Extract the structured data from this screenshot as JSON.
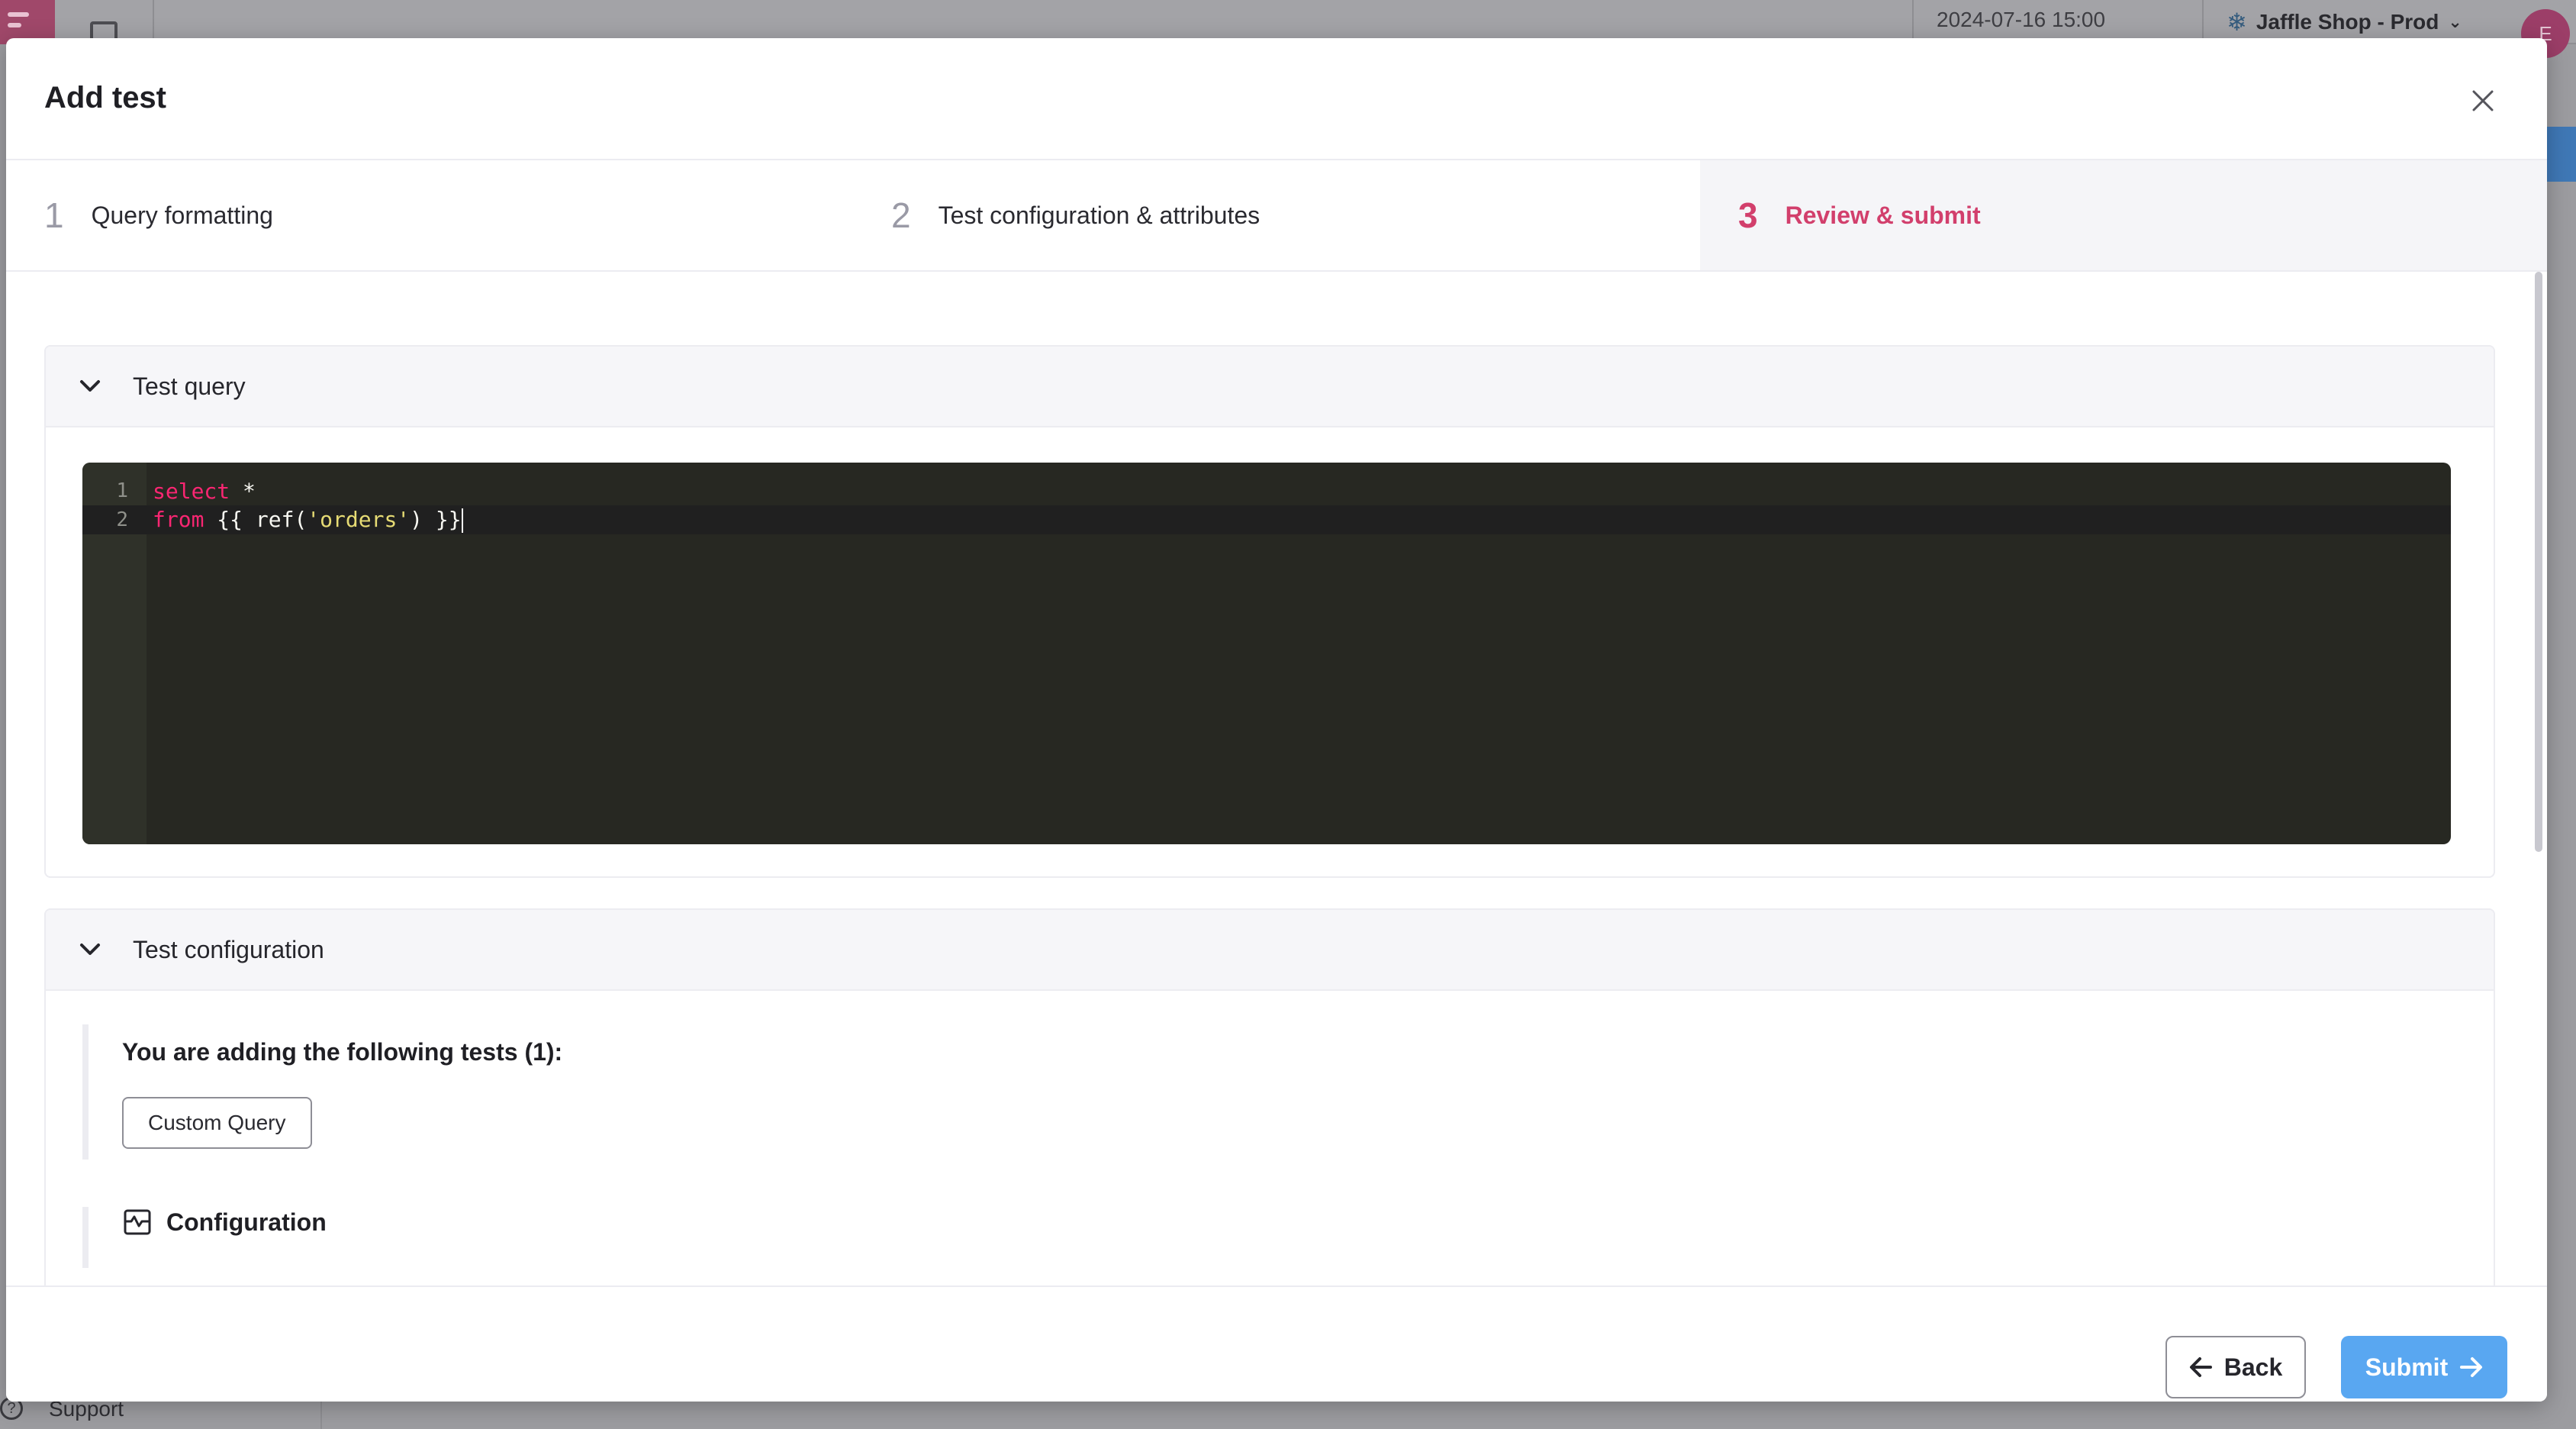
{
  "background": {
    "date": "2024-07-16 15:00",
    "environment": "Jaffle Shop - Prod",
    "avatar_initial": "E",
    "support_label": "Support"
  },
  "modal": {
    "title": "Add test",
    "steps": [
      {
        "num": "1",
        "label": "Query formatting"
      },
      {
        "num": "2",
        "label": "Test configuration & attributes"
      },
      {
        "num": "3",
        "label": "Review & submit"
      }
    ],
    "active_step": 3
  },
  "query_section": {
    "title": "Test query",
    "lines": [
      {
        "num": "1",
        "kw": "select",
        "rest": " *"
      },
      {
        "num": "2",
        "kw": "from",
        "pre": " {{ ref(",
        "str": "'orders'",
        "post": ") }}"
      }
    ]
  },
  "config_section": {
    "title": "Test configuration",
    "adding_text": "You are adding the following tests (1):",
    "tests": [
      "Custom Query"
    ],
    "configuration_label": "Configuration"
  },
  "footer": {
    "back_label": "Back",
    "submit_label": "Submit"
  },
  "colors": {
    "accent": "#d23f6c",
    "submit": "#59a7f1",
    "editor_bg": "#272822"
  }
}
